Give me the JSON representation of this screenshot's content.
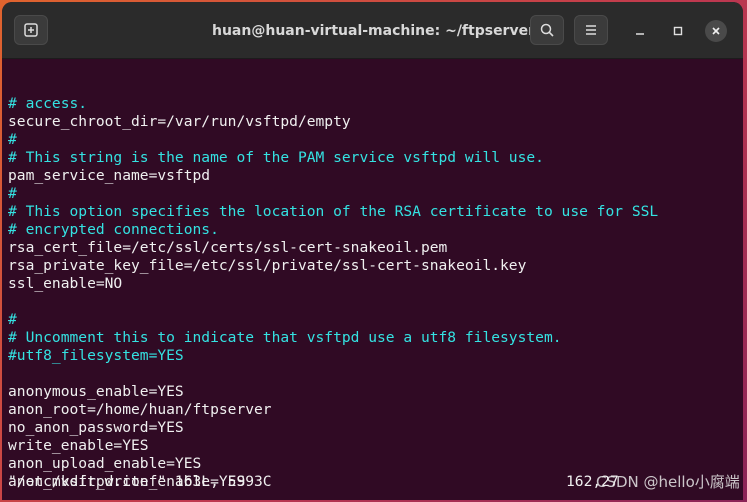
{
  "window": {
    "title": "huan@huan-virtual-machine: ~/ftpserver"
  },
  "icons": {
    "new_tab": "new-tab-icon",
    "search": "search-icon",
    "menu": "hamburger-menu-icon",
    "minimize": "minimize-icon",
    "maximize": "maximize-icon",
    "close": "close-icon"
  },
  "colors": {
    "terminal_bg": "#300a24",
    "comment": "#34e2e2",
    "text": "#f0f0f0",
    "titlebar": "#2b2b2b"
  },
  "terminal": {
    "lines": [
      {
        "text": "# access.",
        "type": "comment"
      },
      {
        "text": "secure_chroot_dir=/var/run/vsftpd/empty",
        "type": "plain"
      },
      {
        "text": "#",
        "type": "comment"
      },
      {
        "text": "# This string is the name of the PAM service vsftpd will use.",
        "type": "comment"
      },
      {
        "text": "pam_service_name=vsftpd",
        "type": "plain"
      },
      {
        "text": "#",
        "type": "comment"
      },
      {
        "text": "# This option specifies the location of the RSA certificate to use for SSL",
        "type": "comment"
      },
      {
        "text": "# encrypted connections.",
        "type": "comment"
      },
      {
        "text": "rsa_cert_file=/etc/ssl/certs/ssl-cert-snakeoil.pem",
        "type": "plain"
      },
      {
        "text": "rsa_private_key_file=/etc/ssl/private/ssl-cert-snakeoil.key",
        "type": "plain"
      },
      {
        "text": "ssl_enable=NO",
        "type": "plain"
      },
      {
        "text": "",
        "type": "plain"
      },
      {
        "text": "#",
        "type": "comment"
      },
      {
        "text": "# Uncomment this to indicate that vsftpd use a utf8 filesystem.",
        "type": "comment"
      },
      {
        "text": "#utf8_filesystem=YES",
        "type": "comment"
      },
      {
        "text": "",
        "type": "plain"
      },
      {
        "text": "anonymous_enable=YES",
        "type": "plain"
      },
      {
        "text": "anon_root=/home/huan/ftpserver",
        "type": "plain"
      },
      {
        "text": "no_anon_password=YES",
        "type": "plain"
      },
      {
        "text": "write_enable=YES",
        "type": "plain"
      },
      {
        "text": "anon_upload_enable=YES",
        "type": "plain"
      },
      {
        "text": "anon_mkdir_write_enable=YES",
        "type": "plain"
      }
    ],
    "status_line": "\"/etc/vsftpd.conf\" 163L, 5993C",
    "cursor_position": "162,27",
    "watermark": "CSDN @hello小腐端"
  }
}
